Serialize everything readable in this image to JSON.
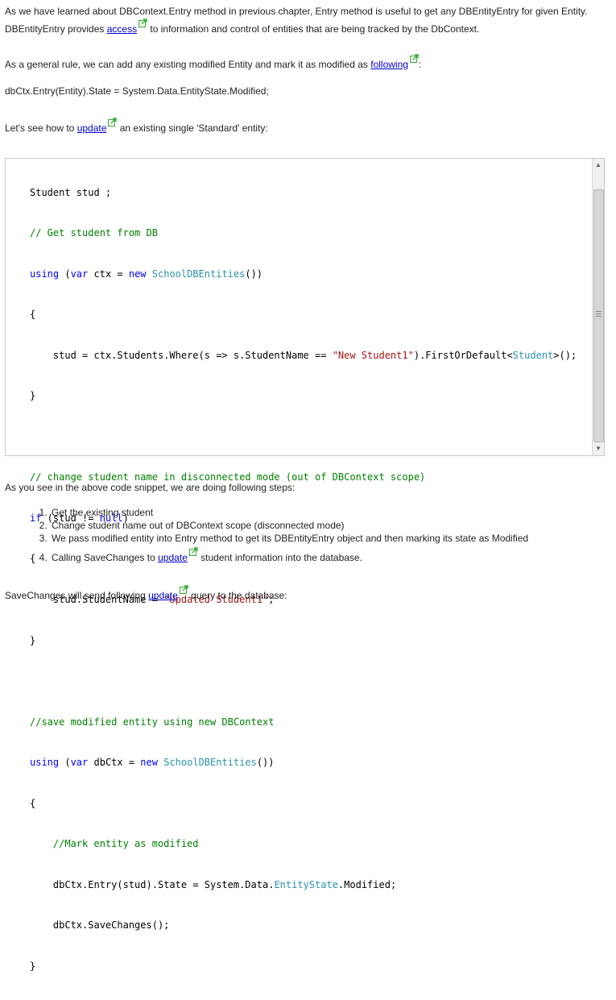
{
  "intro": {
    "part1": "As we have learned about DBContext.Entry method in previous chapter, Entry method is useful to get any DBEntityEntry for given Entity. DBEntityEntry provides ",
    "link": "access",
    "part2": " to information and control of entities that are being tracked by the DbContext."
  },
  "rule": {
    "part1": "As a general rule, we can add any existing modified Entity and mark it as modified as ",
    "link": "following",
    "part2": ":"
  },
  "state_line": "dbCtx.Entry(Entity).State = System.Data.EntityState.Modified;",
  "update_intro": {
    "part1": "Let's see how to ",
    "link": "update",
    "part2": " an existing single 'Standard' entity:"
  },
  "code": {
    "l1": "Student stud ;",
    "l2": "// Get student from DB",
    "l3_kw1": "using",
    "l3_a": " (",
    "l3_kw2": "var",
    "l3_b": " ctx = ",
    "l3_kw3": "new",
    "l3_sp": " ",
    "l3_ty": "SchoolDBEntities",
    "l3_c": "())",
    "l4": "{",
    "l5_a": "    stud = ctx.Students.Where(s => s.StudentName == ",
    "l5_str": "\"New Student1\"",
    "l5_b": ").FirstOrDefault<",
    "l5_ty": "Student",
    "l5_c": ">();",
    "l6": "}",
    "l8": "// change student name in disconnected mode (out of DBContext scope)",
    "l9_kw1": "if",
    "l9_a": " (stud != ",
    "l9_kw2": "null",
    "l9_b": ")",
    "l10": "{",
    "l11_a": "    stud.StudentName = ",
    "l11_str": "\"Updated Student1\"",
    "l11_b": ";",
    "l12": "}",
    "l14": "//save modified entity using new DBContext",
    "l15_kw1": "using",
    "l15_a": " (",
    "l15_kw2": "var",
    "l15_b": " dbCtx = ",
    "l15_kw3": "new",
    "l15_sp": " ",
    "l15_ty": "SchoolDBEntities",
    "l15_c": "())",
    "l16": "{",
    "l17": "    //Mark entity as modified",
    "l18_a": "    dbCtx.Entry(stud).State = System.Data.",
    "l18_ty": "EntityState",
    "l18_b": ".Modified;",
    "l19": "    dbCtx.SaveChanges();",
    "l20": "}"
  },
  "steps_intro": "As you see in the above code snippet, we are doing following steps:",
  "steps": [
    "Get the existing student",
    "Change student name out of DBContext scope (disconnected mode)",
    "We pass modified entity into Entry method to get its DBEntityEntry object and then marking its state as Modified"
  ],
  "step4": {
    "part1": "Calling SaveChanges to ",
    "link": "update",
    "part2": " student information into the database."
  },
  "savechanges": {
    "part1": "SaveChanges will send following ",
    "link": "update",
    "part2": " query to the database:"
  },
  "icons": {
    "external_link": "external-link-icon",
    "scroll_up": "scroll-up-arrow-icon",
    "scroll_down": "scroll-down-arrow-icon"
  },
  "colors": {
    "link": "#0000cc",
    "keyword": "#0000ff",
    "type": "#2b91af",
    "string": "#a31515",
    "comment": "#008000",
    "external_icon": "#33aa33"
  }
}
